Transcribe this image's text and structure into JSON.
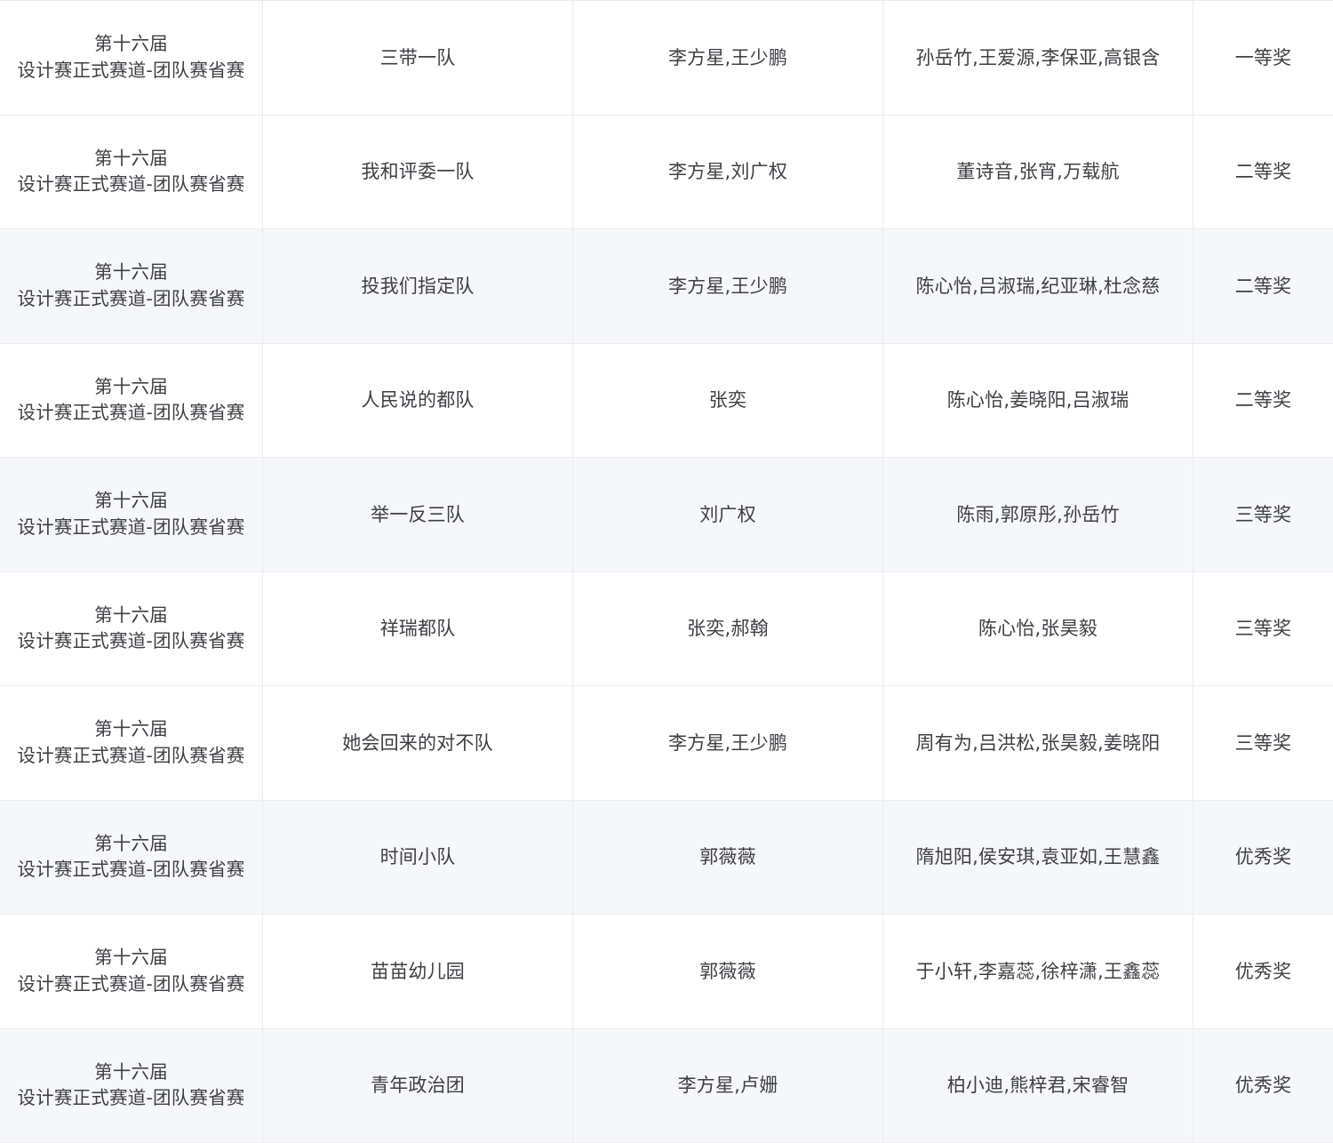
{
  "rows": [
    {
      "edition": "第十六届",
      "track": "设计赛正式赛道-团队赛省赛",
      "team": "三带一队",
      "advisors": "李方星,王少鹏",
      "members": "孙岳竹,王爱源,李保亚,高银含",
      "award": "一等奖"
    },
    {
      "edition": "第十六届",
      "track": "设计赛正式赛道-团队赛省赛",
      "team": "我和评委一队",
      "advisors": "李方星,刘广权",
      "members": "董诗音,张宵,万载航",
      "award": "二等奖"
    },
    {
      "edition": "第十六届",
      "track": "设计赛正式赛道-团队赛省赛",
      "team": "投我们指定队",
      "advisors": "李方星,王少鹏",
      "members": "陈心怡,吕淑瑞,纪亚琳,杜念慈",
      "award": "二等奖"
    },
    {
      "edition": "第十六届",
      "track": "设计赛正式赛道-团队赛省赛",
      "team": "人民说的都队",
      "advisors": "张奕",
      "members": "陈心怡,姜晓阳,吕淑瑞",
      "award": "二等奖"
    },
    {
      "edition": "第十六届",
      "track": "设计赛正式赛道-团队赛省赛",
      "team": "举一反三队",
      "advisors": "刘广权",
      "members": "陈雨,郭原彤,孙岳竹",
      "award": "三等奖"
    },
    {
      "edition": "第十六届",
      "track": "设计赛正式赛道-团队赛省赛",
      "team": "祥瑞都队",
      "advisors": "张奕,郝翰",
      "members": "陈心怡,张昊毅",
      "award": "三等奖"
    },
    {
      "edition": "第十六届",
      "track": "设计赛正式赛道-团队赛省赛",
      "team": "她会回来的对不队",
      "advisors": "李方星,王少鹏",
      "members": "周有为,吕洪松,张昊毅,姜晓阳",
      "award": "三等奖"
    },
    {
      "edition": "第十六届",
      "track": "设计赛正式赛道-团队赛省赛",
      "team": "时间小队",
      "advisors": "郭薇薇",
      "members": "隋旭阳,侯安琪,袁亚如,王慧鑫",
      "award": "优秀奖"
    },
    {
      "edition": "第十六届",
      "track": "设计赛正式赛道-团队赛省赛",
      "team": "苗苗幼儿园",
      "advisors": "郭薇薇",
      "members": "于小轩,李嘉蕊,徐梓潇,王鑫蕊",
      "award": "优秀奖"
    },
    {
      "edition": "第十六届",
      "track": "设计赛正式赛道-团队赛省赛",
      "team": "青年政治团",
      "advisors": "李方星,卢姗",
      "members": "柏小迪,熊梓君,宋睿智",
      "award": "优秀奖"
    }
  ]
}
